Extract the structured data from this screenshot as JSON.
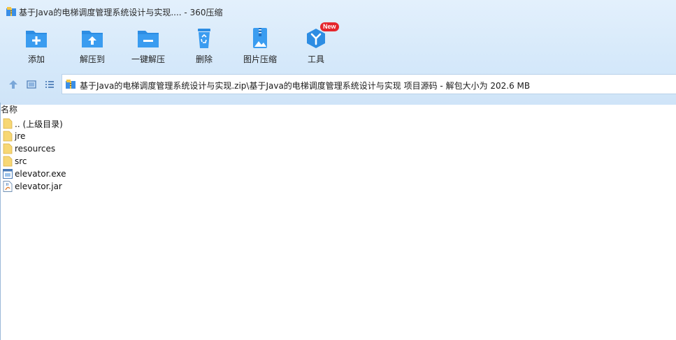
{
  "window": {
    "title": "基于Java的电梯调度管理系统设计与实现.... - 360压缩"
  },
  "toolbar": {
    "buttons": [
      {
        "label": "添加",
        "icon": "add-folder-icon"
      },
      {
        "label": "解压到",
        "icon": "extract-to-icon"
      },
      {
        "label": "一键解压",
        "icon": "one-click-extract-icon"
      },
      {
        "label": "删除",
        "icon": "recycle-bin-icon"
      },
      {
        "label": "图片压缩",
        "icon": "image-compress-icon"
      },
      {
        "label": "工具",
        "icon": "tools-icon",
        "badge": "New"
      }
    ]
  },
  "navigation": {
    "up_icon": "up-arrow-icon",
    "view_icon": "thumbnail-view-icon",
    "list_icon": "list-view-icon"
  },
  "address": {
    "path": "基于Java的电梯调度管理系统设计与实现.zip\\基于Java的电梯调度管理系统设计与实现 项目源码 - 解包大小为 202.6 MB"
  },
  "filelist": {
    "column_name": "名称",
    "items": [
      {
        "name": ".. (上级目录)",
        "type": "folder"
      },
      {
        "name": "jre",
        "type": "folder"
      },
      {
        "name": "resources",
        "type": "folder"
      },
      {
        "name": "src",
        "type": "folder"
      },
      {
        "name": "elevator.exe",
        "type": "exe"
      },
      {
        "name": "elevator.jar",
        "type": "jar"
      }
    ]
  },
  "colors": {
    "accent": "#2a8fe0",
    "topbar_bg": "#d6e9fa",
    "badge": "#e5262c",
    "folder": "#f7d774"
  }
}
